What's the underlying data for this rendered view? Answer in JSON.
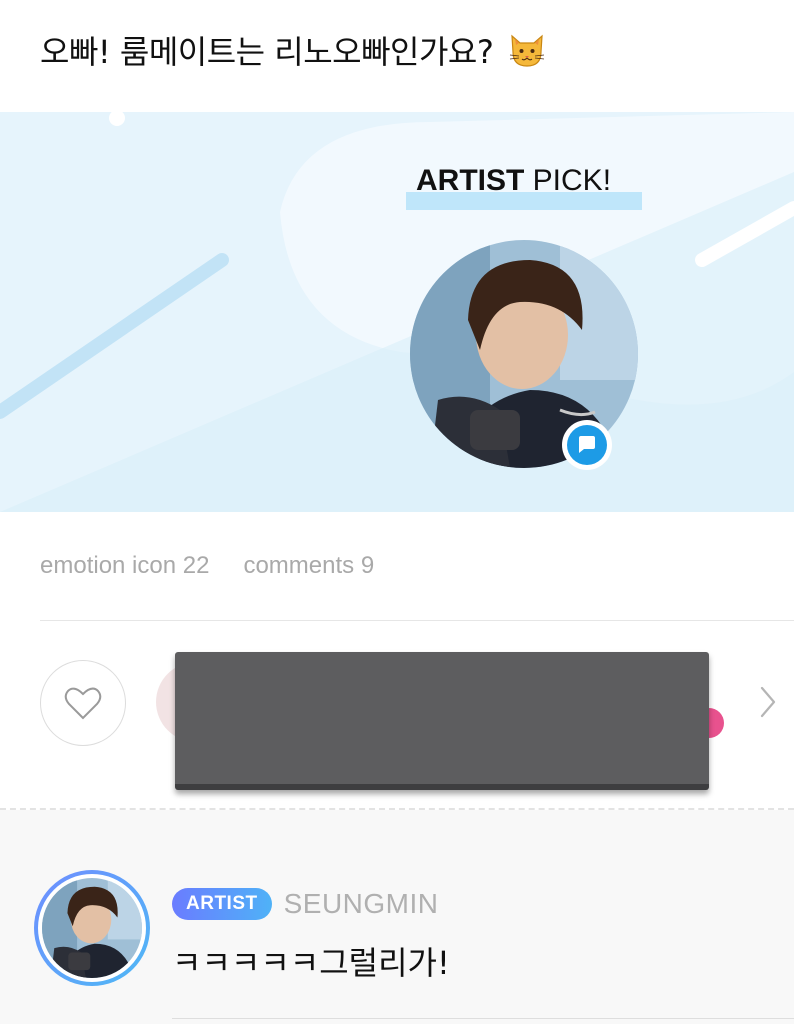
{
  "post": {
    "title": "오빠! 룸메이트는 리노오빠인가요?",
    "title_emoji": "cat-face-emoji"
  },
  "banner": {
    "label_bold": "ARTIST",
    "label_light": "PICK!",
    "background_color": "#e6f4fc",
    "highlight_color": "#bfe6fa",
    "badge_icon": "chat-bubble-icon",
    "badge_color": "#1d9be6"
  },
  "stats": {
    "emotion": "emotion icon 22",
    "comments": "comments 9"
  },
  "reactions": {
    "like_icon": "heart-outline-icon",
    "more_icon": "chevron-right-icon",
    "accent_color": "#e8528e"
  },
  "comment": {
    "badge": "ARTIST",
    "author": "SEUNGMIN",
    "text": "ㅋㅋㅋㅋㅋ그럴리가!"
  }
}
